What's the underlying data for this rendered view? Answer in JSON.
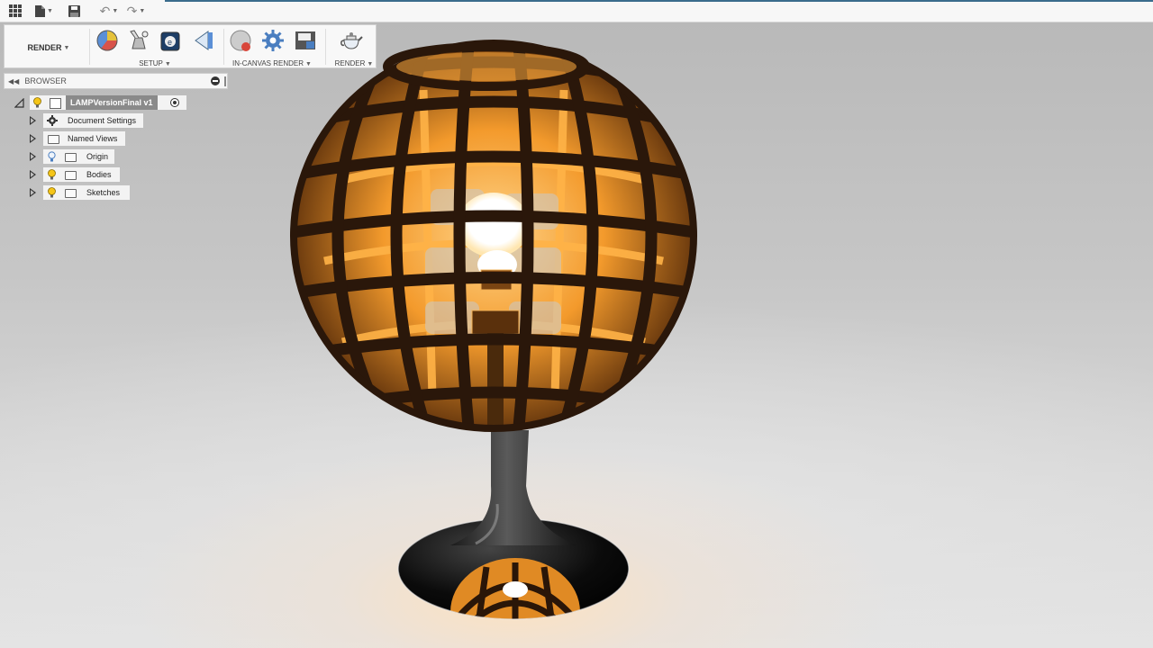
{
  "toolbar": {
    "workspace_label": "RENDER",
    "groups": [
      {
        "label": "SETUP"
      },
      {
        "label": "IN-CANVAS RENDER"
      },
      {
        "label": "RENDER"
      }
    ]
  },
  "browser": {
    "title": "BROWSER",
    "root": {
      "label": "LAMPVersionFinal v1"
    },
    "items": [
      {
        "label": "Document Settings",
        "icon": "gear-icon"
      },
      {
        "label": "Named Views",
        "icon": "folder-icon"
      },
      {
        "label": "Origin",
        "icon": "folder-icon"
      },
      {
        "label": "Bodies",
        "icon": "folder-icon"
      },
      {
        "label": "Sketches",
        "icon": "folder-icon"
      }
    ]
  },
  "colors": {
    "accent": "#3a6c8c",
    "lamp_glow": "#f7a63a",
    "lamp_frame": "#2a1a0c",
    "bulb_on": "#f5c518"
  }
}
